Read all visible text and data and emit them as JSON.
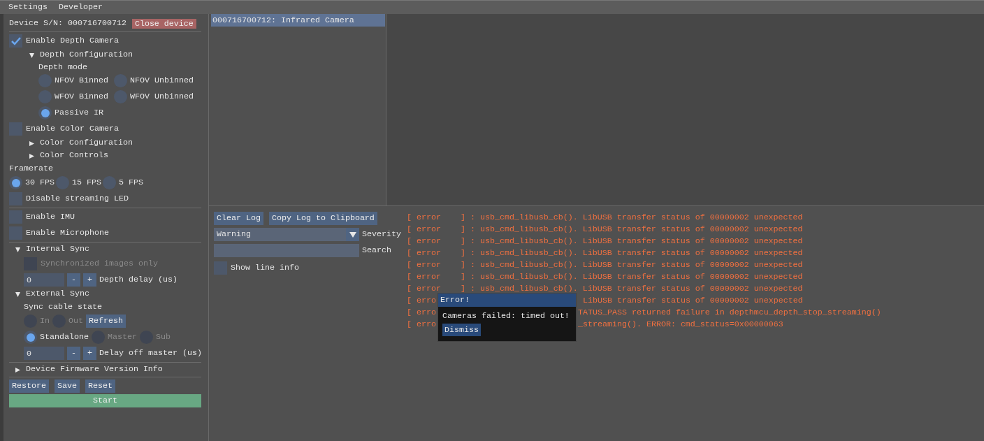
{
  "menu": [
    {
      "label": "Settings"
    },
    {
      "label": "Developer"
    }
  ],
  "device": {
    "serial": "Device S/N: 000716700712",
    "close_button": "Close device"
  },
  "depth_camera": {
    "label": "Enable Depth Camera",
    "checked": true,
    "config": {
      "label": "Depth Configuration",
      "expanded": true,
      "mode_label": "Depth mode",
      "modes": [
        {
          "label": "NFOV Binned",
          "selected": false
        },
        {
          "label": "NFOV Unbinned",
          "selected": false
        },
        {
          "label": "WFOV Binned",
          "selected": false
        },
        {
          "label": "WFOV Unbinned",
          "selected": false
        },
        {
          "label": "Passive IR",
          "selected": true
        }
      ]
    }
  },
  "color_camera": {
    "label": "Enable Color Camera",
    "checked": false,
    "sections": [
      {
        "label": "Color Configuration",
        "expanded": false
      },
      {
        "label": "Color Controls",
        "expanded": false
      }
    ]
  },
  "framerate": {
    "label": "Framerate",
    "options": [
      {
        "label": "30 FPS",
        "selected": true
      },
      {
        "label": "15 FPS",
        "selected": false
      },
      {
        "label": "5 FPS",
        "selected": false
      }
    ]
  },
  "led": {
    "label": "Disable streaming LED",
    "checked": false
  },
  "sensors": [
    {
      "label": "Enable IMU",
      "checked": false
    },
    {
      "label": "Enable Microphone",
      "checked": false
    }
  ],
  "internal_sync": {
    "label": "Internal Sync",
    "expanded": true,
    "sync_images": {
      "label": "Synchronized images only",
      "checked": false,
      "disabled": true
    },
    "depth_delay": {
      "value": "0",
      "minus": "-",
      "plus": "+",
      "label": "Depth delay (us)"
    }
  },
  "external_sync": {
    "label": "External Sync",
    "expanded": true,
    "cable_label": "Sync cable state",
    "cable_states": [
      {
        "label": "In",
        "selected": false,
        "disabled": true
      },
      {
        "label": "Out",
        "selected": false,
        "disabled": true
      }
    ],
    "refresh": "Refresh",
    "modes": [
      {
        "label": "Standalone",
        "selected": true,
        "disabled": false
      },
      {
        "label": "Master",
        "selected": false,
        "disabled": true
      },
      {
        "label": "Sub",
        "selected": false,
        "disabled": true
      }
    ],
    "delay": {
      "value": "0",
      "minus": "-",
      "plus": "+",
      "label": "Delay off master (us)"
    }
  },
  "firmware": {
    "label": "Device Firmware Version Info",
    "expanded": false
  },
  "buttons": [
    {
      "label": "Restore"
    },
    {
      "label": "Save"
    },
    {
      "label": "Reset"
    }
  ],
  "start": "Start",
  "devices": [
    {
      "label": "000716700712: Infrared Camera",
      "selected": true
    }
  ],
  "log_controls": {
    "clear": "Clear Log",
    "copy": "Copy Log to Clipboard",
    "severity": {
      "value": "Warning",
      "label": "Severity"
    },
    "search": {
      "label": "Search"
    },
    "line_info": {
      "label": "Show line info",
      "checked": false
    }
  },
  "log": [
    {
      "kind": "full",
      "text": "[ error    ] : usb_cmd_libusb_cb(). LibUSB transfer status of 00000002 unexpected"
    },
    {
      "kind": "full",
      "text": "[ error    ] : usb_cmd_libusb_cb(). LibUSB transfer status of 00000002 unexpected"
    },
    {
      "kind": "full",
      "text": "[ error    ] : usb_cmd_libusb_cb(). LibUSB transfer status of 00000002 unexpected"
    },
    {
      "kind": "full",
      "text": "[ error    ] : usb_cmd_libusb_cb(). LibUSB transfer status of 00000002 unexpected"
    },
    {
      "kind": "full",
      "text": "[ error    ] : usb_cmd_libusb_cb(). LibUSB transfer status of 00000002 unexpected"
    },
    {
      "kind": "full",
      "text": "[ error    ] : usb_cmd_libusb_cb(). LibUSB transfer status of 00000002 unexpected"
    },
    {
      "kind": "full",
      "text": "[ error    ] : usb_cmd_libusb_cb(). LibUSB transfer status of 00000002 unexpected"
    },
    {
      "kind": "partial",
      "start": "[ erro",
      "end": "LibUSB transfer status of 00000002 unexpected"
    },
    {
      "kind": "partial",
      "start": "[ erro",
      "end": "TATUS_PASS returned failure in depthmcu_depth_stop_streaming()"
    },
    {
      "kind": "partial",
      "start": "[ erro",
      "end": "_streaming(). ERROR: cmd_status=0x00000063"
    }
  ],
  "dialog": {
    "title": "Error!",
    "message": "Cameras failed: timed out!",
    "button": "Dismiss"
  }
}
